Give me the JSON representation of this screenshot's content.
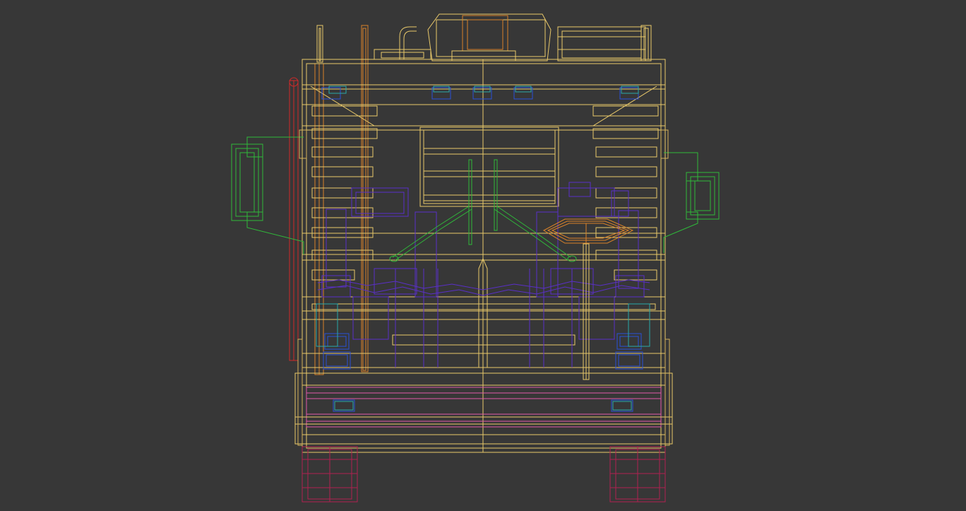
{
  "viewport": {
    "background": "#373737",
    "view": "front",
    "render_mode": "wireframe",
    "subject": "truck"
  },
  "colors": {
    "body": "#e8c86a",
    "cabin_parts": "#2a50d8",
    "interior": "#5a2fc8",
    "mirrors": "#2fb83a",
    "exhaust": "#d9822a",
    "antenna": "#d12a2a",
    "bumper": "#e05aa8",
    "wheels": "#b02050",
    "lights": "#2aa8a8"
  }
}
